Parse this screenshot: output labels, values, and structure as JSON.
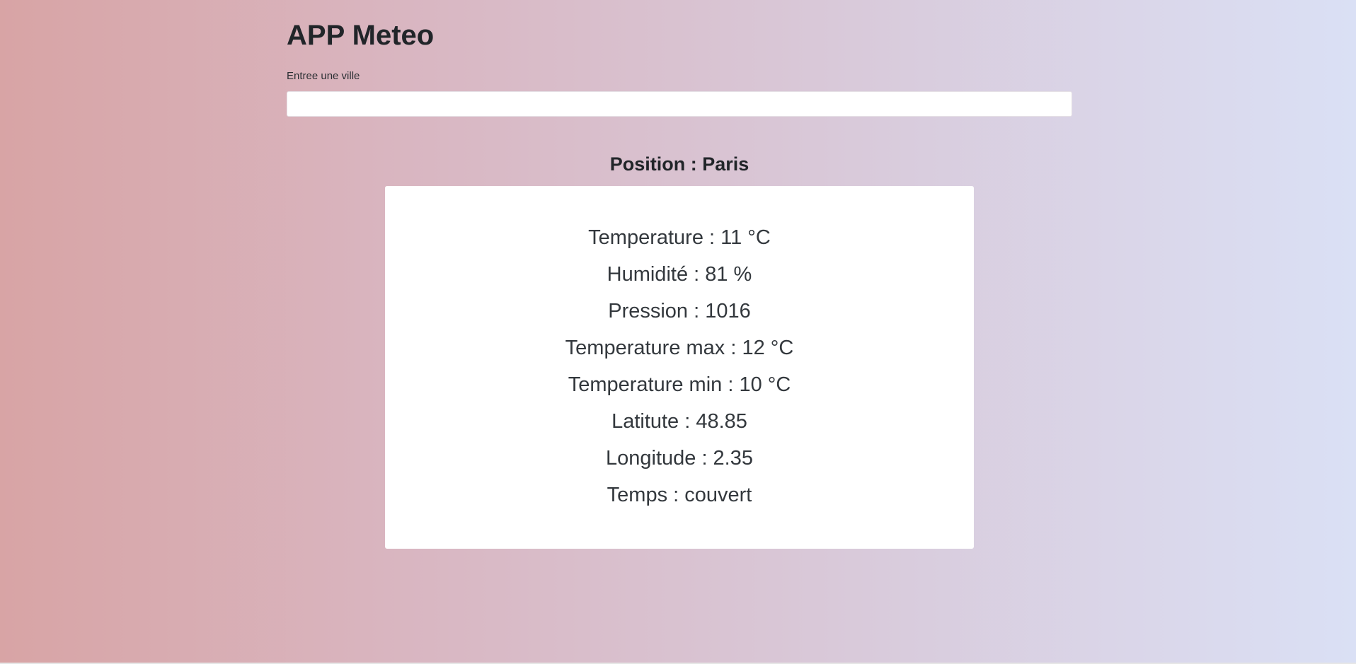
{
  "app": {
    "title": "APP Meteo"
  },
  "search": {
    "label": "Entree une ville",
    "value": ""
  },
  "position": {
    "title": "Position : Paris"
  },
  "weather": {
    "items": [
      "Temperature : 11 °C",
      "Humidité : 81 %",
      "Pression : 1016",
      "Temperature max : 12 °C",
      "Temperature min : 10 °C",
      "Latitute : 48.85",
      "Longitude : 2.35",
      "Temps : couvert"
    ]
  },
  "colors": {
    "background_left": "#d8a4a5",
    "background_right": "#dae0f5",
    "card": "#ffffff",
    "text": "#212529"
  }
}
